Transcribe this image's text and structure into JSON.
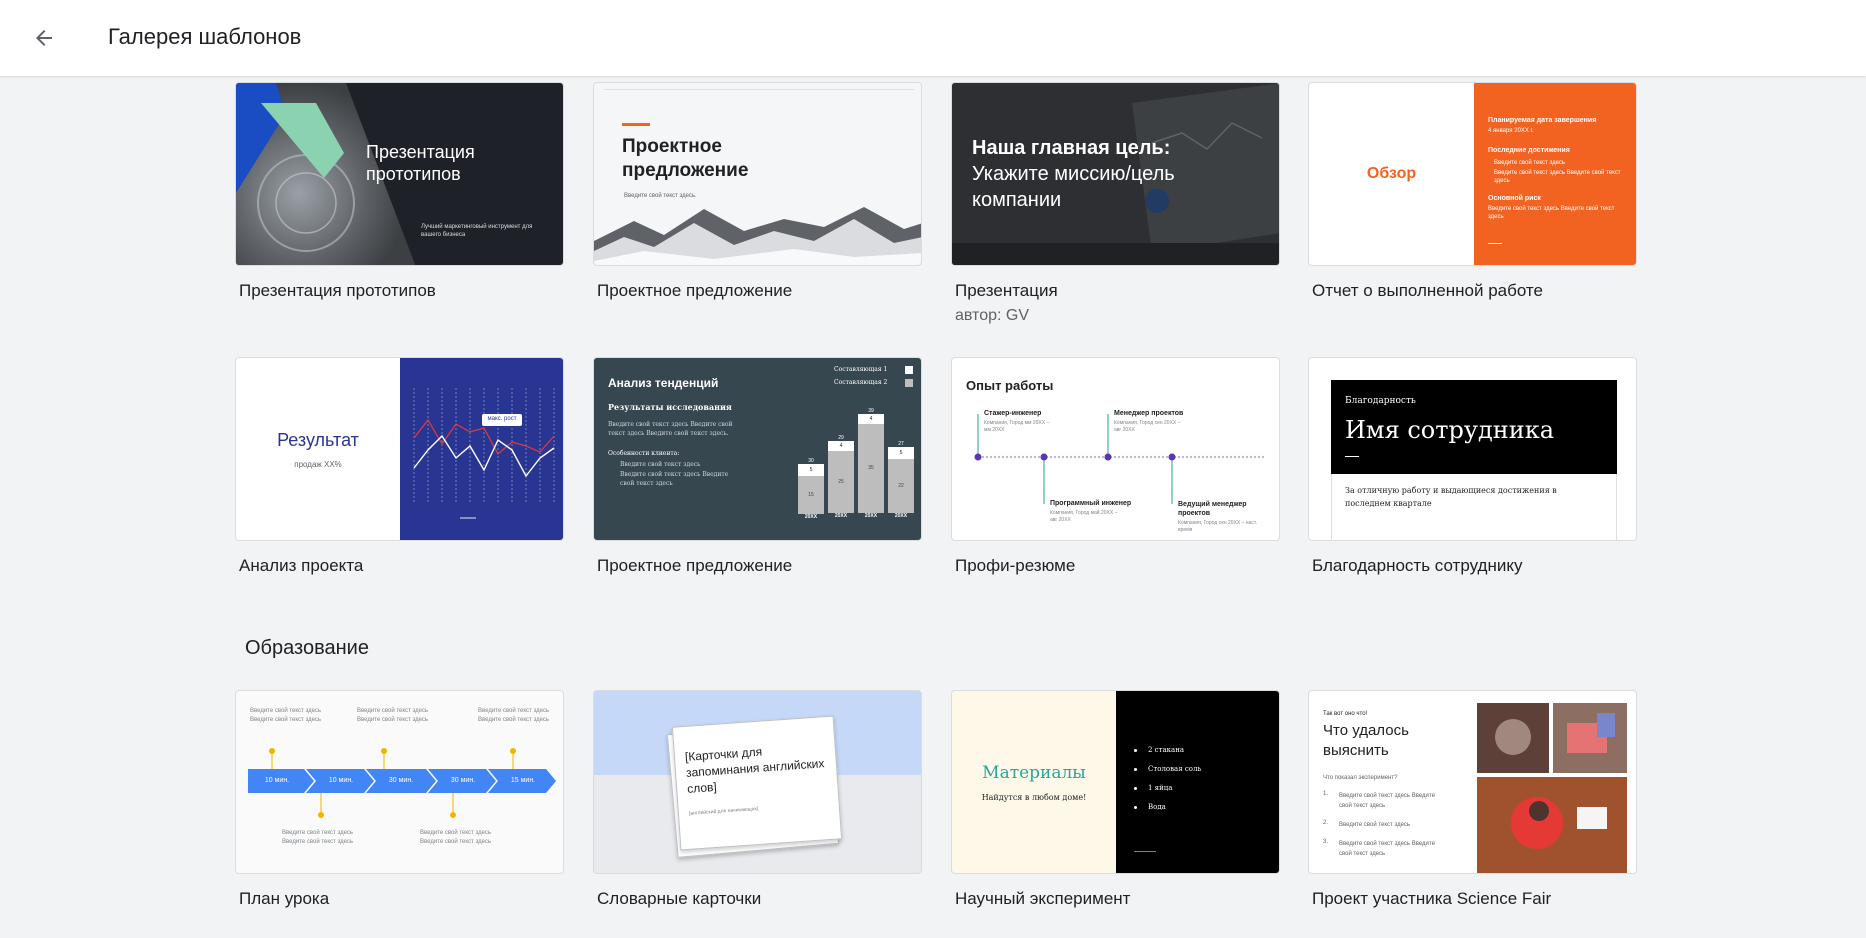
{
  "header": {
    "title": "Галерея шаблонов",
    "back_icon": "arrow-back-icon"
  },
  "colors": {
    "orange": "#f26322",
    "navy": "#283593",
    "dark": "#1e2128",
    "slate": "#37474f",
    "teal": "#26a69a",
    "purple": "#5e35b1",
    "blue": "#4285f4",
    "amber": "#f4b400"
  },
  "rows": [
    {
      "templates": [
        {
          "title": "Презентация прототипов",
          "thumb": {
            "heading": "Презентация прототипов",
            "tagline": "Лучший маркетинговый инструмент для вашего бизнеса"
          }
        },
        {
          "title": "Проектное предложение",
          "thumb": {
            "heading": "Проектное предложение",
            "subtext": "Введите свой текст здесь."
          }
        },
        {
          "title": "Презентация",
          "subtitle": "автор: GV",
          "thumb": {
            "heading": "Наша главная цель:",
            "subheading": "Укажите миссию/цель компании"
          }
        },
        {
          "title": "Отчет о выполненной работе",
          "thumb": {
            "overview": "Обзор",
            "date_label": "Планируемая дата завершения",
            "date_value": "4 января 20XX г.",
            "achievements_label": "Последние достижения",
            "bullet_1": "Введите свой текст здесь",
            "bullet_2": "Введите свой текст здесь Введите свой текст здесь",
            "risk_label": "Основной риск",
            "risk_text": "Введите свой текст здесь Введите свой текст здесь"
          }
        }
      ]
    },
    {
      "templates": [
        {
          "title": "Анализ проекта",
          "thumb": {
            "heading": "Результат",
            "subtext": "продаж XX%",
            "callout": "макс. рост"
          }
        },
        {
          "title": "Проектное предложение",
          "thumb": {
            "heading": "Анализ тенденций",
            "subheading": "Результаты исследования",
            "body": "Введите свой текст здесь Введите свой текст здесь Введите свой текст здесь.",
            "features": "Особенности клиента:",
            "bullet_1": "Введите свой текст здесь",
            "bullet_2": "Введите свой текст здесь Введите свой текст здесь",
            "legend_1": "Составляющая 1",
            "legend_2": "Составляющая 2",
            "bars": [
              {
                "label": "20XX",
                "top": "30",
                "mid": "5",
                "low": "15"
              },
              {
                "label": "20XX",
                "top": "29",
                "mid": "4",
                "low": "25"
              },
              {
                "label": "20XX",
                "top": "39",
                "mid": "4",
                "low": "35"
              },
              {
                "label": "20XX",
                "top": "27",
                "mid": "5",
                "low": "22"
              }
            ]
          }
        },
        {
          "title": "Профи-резюме",
          "thumb": {
            "heading": "Опыт работы",
            "job_1": "Стажер-инженер",
            "job_1_meta": "Компания, Город мм 20XX – мм 20XX",
            "job_2": "Менеджер проектов",
            "job_2_meta": "Компания, Город сен 20XX – авг 20XX",
            "job_3": "Программный инженер",
            "job_3_meta": "Компания, Город май 20XX – авг 20XX",
            "job_4": "Ведущий менеджер проектов",
            "job_4_meta": "Компания, Город сен 20XX – наст. время"
          }
        },
        {
          "title": "Благодарность сотруднику",
          "thumb": {
            "label": "Благодарность",
            "heading": "Имя сотрудника",
            "body": "За отличную работу и выдающиеся достижения в последнем квартале"
          }
        }
      ]
    }
  ],
  "education": {
    "section_title": "Образование",
    "templates": [
      {
        "title": "План урока",
        "thumb": {
          "note": "Введите свой текст здесь Введите свой текст здесь",
          "steps": [
            "10 мин.",
            "10 мин.",
            "30 мин.",
            "30 мин.",
            "15 мин."
          ]
        }
      },
      {
        "title": "Словарные карточки",
        "thumb": {
          "heading": "[Карточки для запоминания английских слов]",
          "subtext": "[английский для начинающих]"
        }
      },
      {
        "title": "Научный эксперимент",
        "thumb": {
          "heading": "Материалы",
          "subtext": "Найдутся в любом доме!",
          "items": [
            "2 стакана",
            "Столовая соль",
            "1 яйца",
            "Вода"
          ]
        }
      },
      {
        "title": "Проект участника Science Fair",
        "thumb": {
          "kicker": "Так вот оно что!",
          "heading": "Что удалось выяснить",
          "question": "Что показал эксперимент?",
          "items": [
            "Введите свой текст здесь Введите свой текст здесь",
            "Введите свой текст здесь",
            "Введите свой текст здесь Введите свой текст здесь"
          ]
        }
      }
    ]
  }
}
